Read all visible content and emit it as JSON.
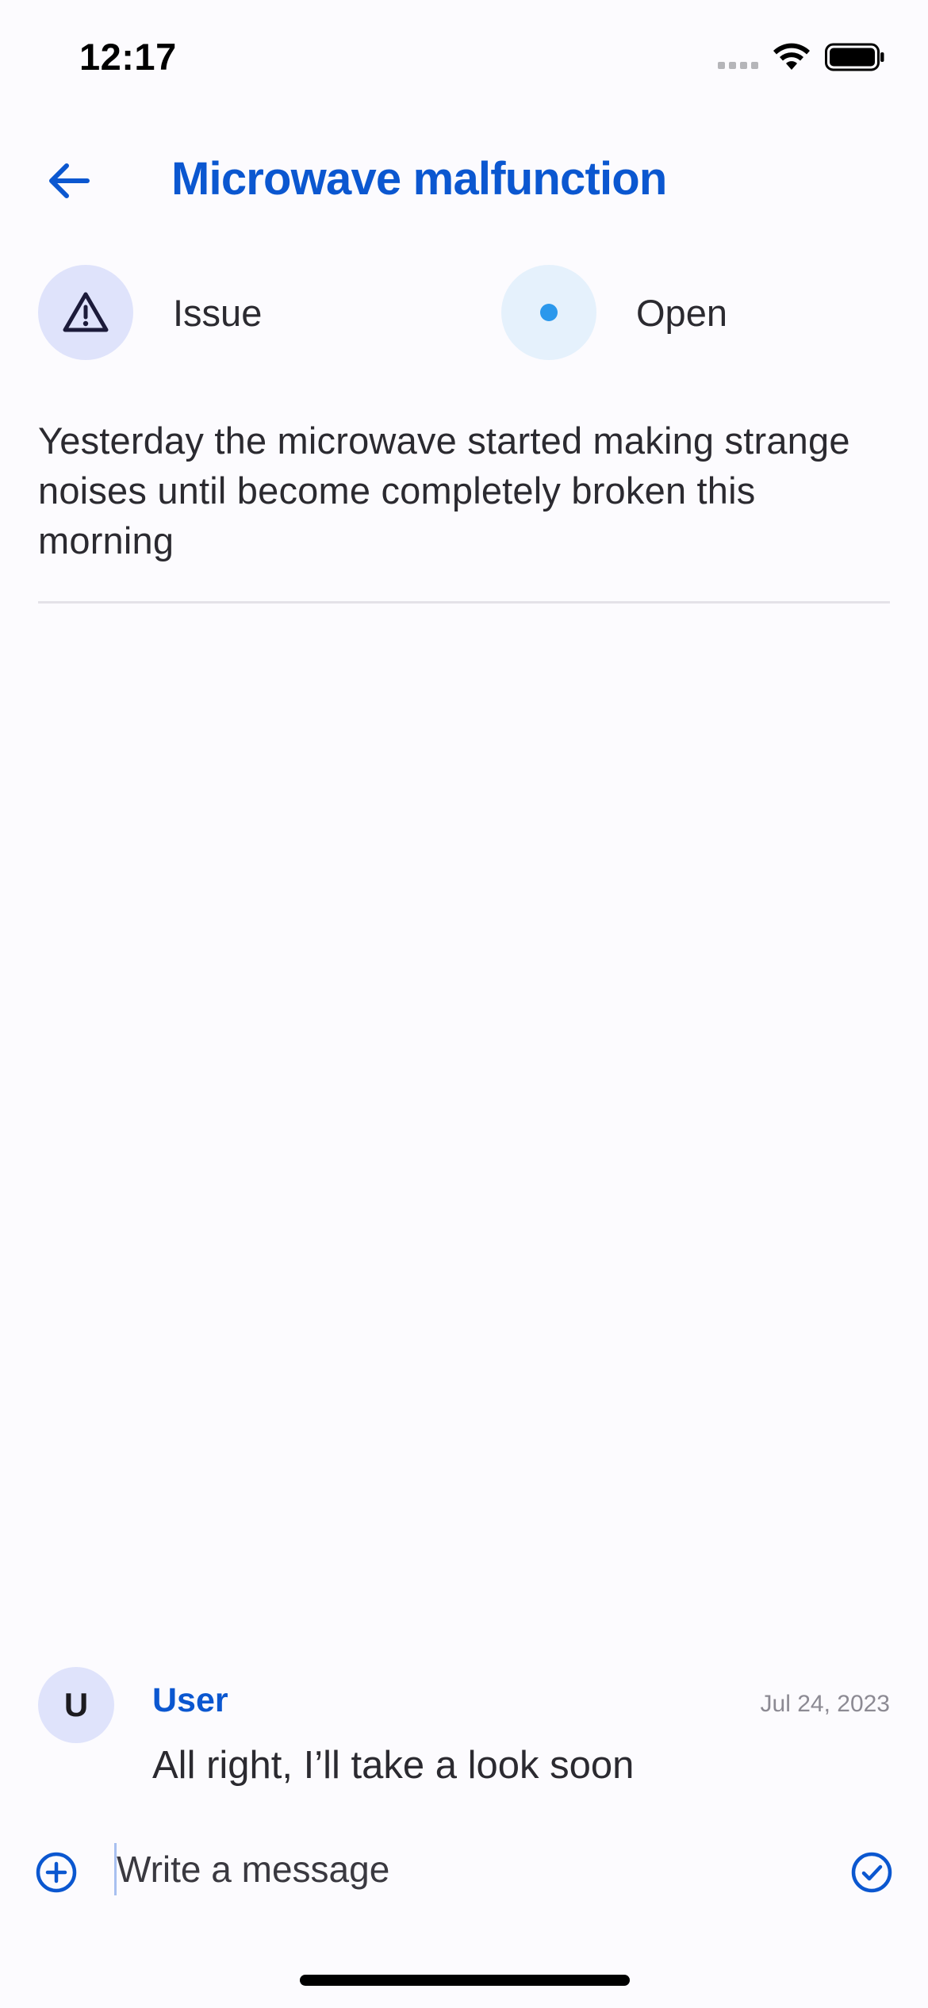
{
  "status_bar": {
    "time": "12:17"
  },
  "header": {
    "back_icon": "arrow-left-icon",
    "title": "Microwave malfunction"
  },
  "ticket": {
    "type": {
      "icon": "warning-triangle-icon",
      "label": "Issue"
    },
    "status": {
      "icon": "status-dot-icon",
      "label": "Open",
      "color": "#2b98ec"
    },
    "description": "Yesterday the microwave started making strange noises until become completely broken this morning"
  },
  "messages": [
    {
      "avatar_initial": "U",
      "author": "User",
      "date": "Jul 24, 2023",
      "text": "All right, I’ll take a look soon"
    }
  ],
  "composer": {
    "attach_icon": "plus-circle-icon",
    "placeholder": "Write a message",
    "send_icon": "check-circle-icon"
  },
  "colors": {
    "accent": "#0b57d0",
    "background": "#fcfbfe",
    "chip_type_bg": "#dfe3fb",
    "chip_status_bg": "#e5f1fc"
  }
}
